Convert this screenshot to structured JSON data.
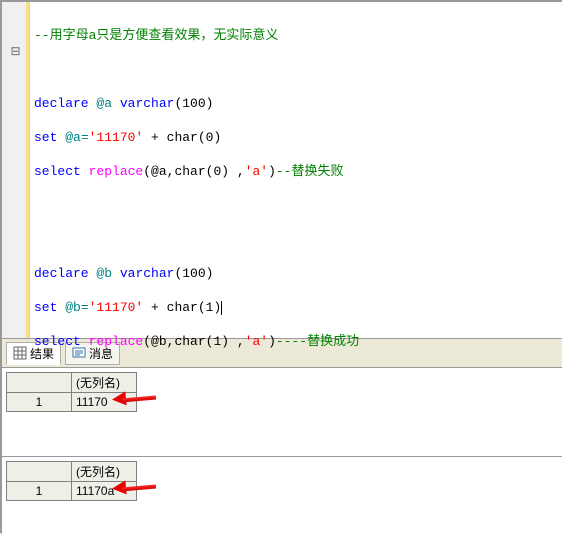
{
  "code": {
    "comment_top": "--用字母a只是方便查看效果，无实际意义",
    "block1": {
      "declare_kw": "declare",
      "var": "@a",
      "type": "varchar",
      "typearg": "(100)",
      "set_kw": "set",
      "assign": "@a=",
      "str": "'11170'",
      "concat": " + char(0)",
      "select_kw": "select",
      "func": "replace",
      "args_open": "(@a,char(0) ,",
      "arg_str": "'a'",
      "args_close": ")",
      "comment": "--替换失败"
    },
    "block2": {
      "declare_kw": "declare",
      "var": "@b",
      "type": "varchar",
      "typearg": "(100)",
      "set_kw": "set",
      "assign": "@b=",
      "str": "'11170'",
      "concat": " + char(1)",
      "select_kw": "select",
      "func": "replace",
      "args_open": "(@b,char(1) ,",
      "arg_str": "'a'",
      "args_close": ")",
      "comment": "----替换成功"
    }
  },
  "tabs": {
    "results": "结果",
    "messages": "消息"
  },
  "grid": {
    "col_header": "(无列名)",
    "rownum": "1",
    "val1": "11170",
    "val2": "11170a"
  }
}
